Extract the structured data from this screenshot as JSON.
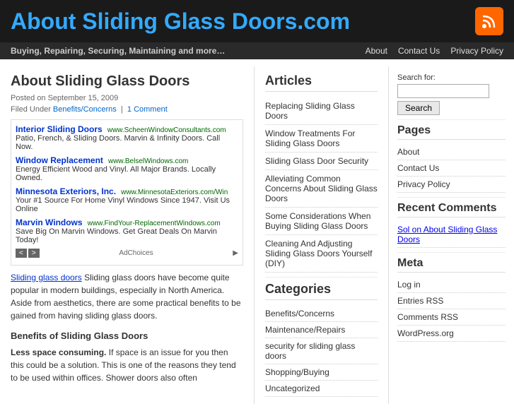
{
  "header": {
    "site_title": "About Sliding Glass Doors.com",
    "rss_icon": "rss"
  },
  "navbar": {
    "tagline": "Buying, Repairing, Securing, Maintaining and more…",
    "links": [
      {
        "label": "About",
        "href": "#"
      },
      {
        "label": "Contact Us",
        "href": "#"
      },
      {
        "label": "Privacy Policy",
        "href": "#"
      }
    ]
  },
  "content": {
    "post_title": "About Sliding Glass Doors",
    "post_date": "Posted on September 15, 2009",
    "filed_under": "Filed Under",
    "category_link": "Benefits/Concerns",
    "comment_link": "1 Comment",
    "ads": [
      {
        "link_text": "Interior Sliding Doors",
        "url_text": "www.ScheenWindowConsultants.com",
        "desc": "Patio, French, & Sliding Doors. Marvin & Infinity Doors. Call Now."
      },
      {
        "link_text": "Window Replacement",
        "url_text": "www.BelselWindows.com",
        "desc": "Energy Efficient Wood and Vinyl. All Major Brands. Locally Owned."
      },
      {
        "link_text": "Minnesota Exteriors, Inc.",
        "url_text": "www.MinnesotaExteriors.com/Win",
        "desc": "Your #1 Source For Home Vinyl Windows Since 1947. Visit Us Online"
      },
      {
        "link_text": "Marvin Windows",
        "url_text": "www.FindYour-ReplacementWindows.com",
        "desc": "Save Big On Marvin Windows. Get Great Deals On Marvin Today!"
      }
    ],
    "ad_choices": "AdChoices",
    "body_text": "Sliding glass doors have become quite popular in modern buildings, especially in North America. Aside from aesthetics, there are some practical benefits to be gained from having sliding glass doors.",
    "benefits_heading": "Benefits of Sliding Glass Doors",
    "benefit1_bold": "Less space consuming.",
    "benefit1_text": " If space is an issue for you then this could be a solution. This is one of the reasons they tend to be used within offices. Shower doors also often"
  },
  "middle": {
    "articles_heading": "Articles",
    "articles": [
      {
        "label": "Replacing Sliding Glass Doors"
      },
      {
        "label": "Window Treatments For Sliding Glass Doors"
      },
      {
        "label": "Sliding Glass Door Security"
      },
      {
        "label": "Alleviating Common Concerns About Sliding Glass Doors"
      },
      {
        "label": "Some Considerations When Buying Sliding Glass Doors"
      },
      {
        "label": "Cleaning And Adjusting Sliding Glass Doors Yourself (DIY)"
      }
    ],
    "categories_heading": "Categories",
    "categories": [
      {
        "label": "Benefits/Concerns"
      },
      {
        "label": "Maintenance/Repairs"
      },
      {
        "label": "security for sliding glass doors"
      },
      {
        "label": "Shopping/Buying"
      },
      {
        "label": "Uncategorized"
      }
    ]
  },
  "sidebar": {
    "search_label": "Search for:",
    "search_placeholder": "",
    "search_button": "Search",
    "pages_heading": "Pages",
    "pages": [
      {
        "label": "About"
      },
      {
        "label": "Contact Us"
      },
      {
        "label": "Privacy Policy"
      }
    ],
    "recent_comments_heading": "Recent Comments",
    "recent_comments": [
      {
        "label": "Sol on About Sliding Glass Doors"
      }
    ],
    "meta_heading": "Meta",
    "meta_links": [
      {
        "label": "Log in"
      },
      {
        "label": "Entries RSS"
      },
      {
        "label": "Comments RSS"
      },
      {
        "label": "WordPress.org"
      }
    ]
  }
}
